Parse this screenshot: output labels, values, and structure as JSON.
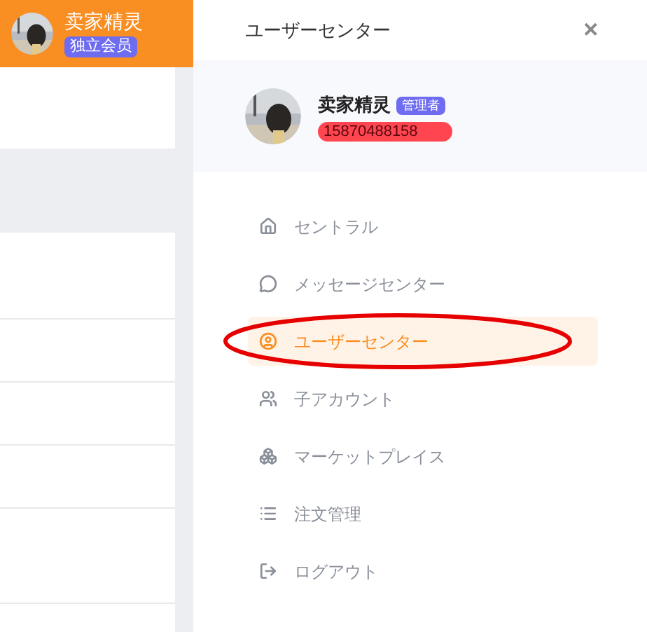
{
  "app_header": {
    "user_name": "卖家精灵",
    "membership": "独立会员"
  },
  "drawer": {
    "title": "ユーザーセンター",
    "close": "✕",
    "profile": {
      "name": "卖家精灵",
      "role": "管理者",
      "phone": "15870488158",
      "phone_highlighted": true
    },
    "menu": [
      {
        "label": "セントラル",
        "selected": false
      },
      {
        "label": "メッセージセンター",
        "selected": false
      },
      {
        "label": "ユーザーセンター",
        "selected": true,
        "circled": true
      },
      {
        "label": "子アカウント",
        "selected": false
      },
      {
        "label": "マーケットプレイス",
        "selected": false
      },
      {
        "label": "注文管理",
        "selected": false
      },
      {
        "label": "ログアウト",
        "selected": false
      }
    ]
  }
}
